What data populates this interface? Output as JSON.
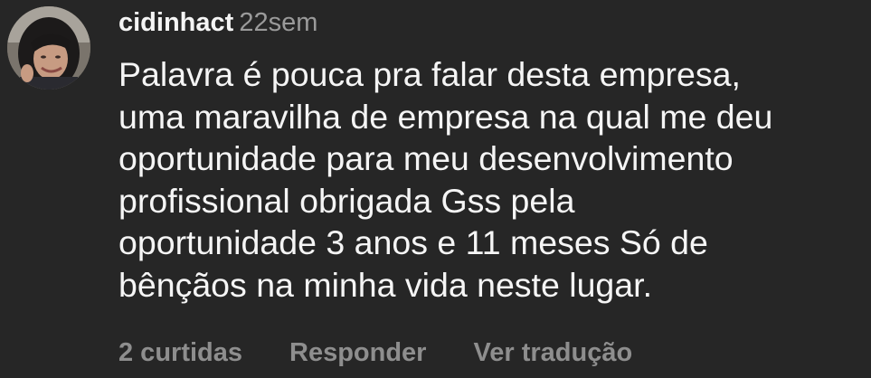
{
  "comment": {
    "username": "cidinhact",
    "time": "22sem",
    "text_lines": [
      "Palavra é  pouca pra falar desta empresa,",
      "uma maravilha de empresa na qual me deu",
      "oportunidade para meu desenvolvimento",
      "profissional obrigada Gss pela",
      "oportunidade 3 anos e 11 meses Só de",
      "bênçãos na minha vida neste lugar."
    ],
    "actions": {
      "likes": "2 curtidas",
      "reply": "Responder",
      "translate": "Ver tradução"
    }
  },
  "colors": {
    "background": "#262626",
    "primary_text": "#f5f5f5",
    "secondary_text": "#8e8e8e"
  }
}
